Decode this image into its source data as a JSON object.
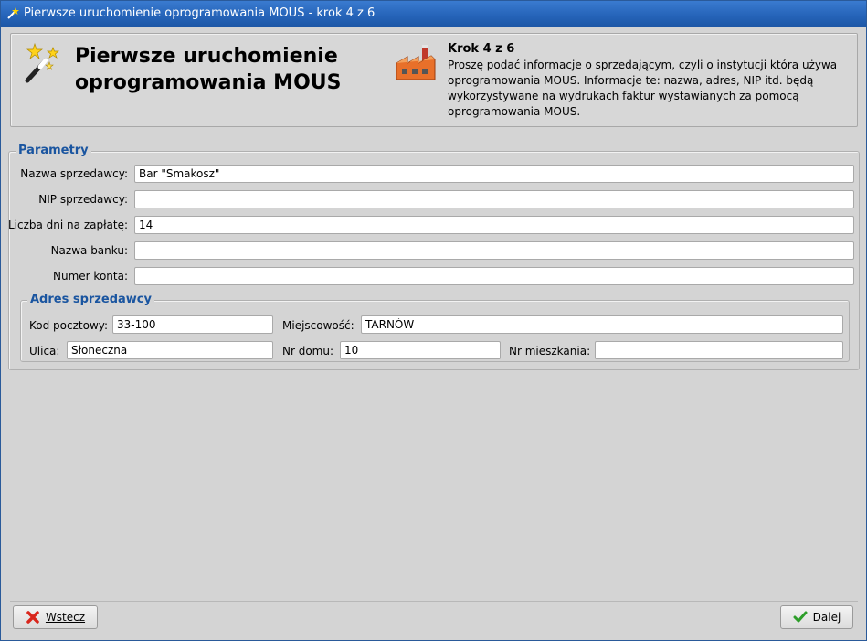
{
  "window": {
    "title": "Pierwsze uruchomienie oprogramowania MOUS - krok 4 z 6",
    "icon": "wand-icon"
  },
  "header": {
    "big_title": "Pierwsze uruchomienie oprogramowania MOUS",
    "step_title": "Krok 4 z 6",
    "step_description": "Proszę podać informacje o sprzedającym, czyli o instytucji która używa oprogramowania MOUS. Informacje te: nazwa, adres, NIP itd. będą wykorzystywane na wydrukach faktur wystawianych za pomocą oprogramowania MOUS.",
    "left_icon": "magic-wand-icon",
    "right_icon": "factory-icon"
  },
  "params": {
    "legend": "Parametry",
    "seller_name_label": "Nazwa sprzedawcy:",
    "seller_name_value": "Bar \"Smakosz\"",
    "nip_label": "NIP sprzedawcy:",
    "nip_value": "",
    "days_label": "Liczba dni na zapłatę:",
    "days_value": "14",
    "bank_label": "Nazwa banku:",
    "bank_value": "",
    "account_label": "Numer konta:",
    "account_value": ""
  },
  "address": {
    "legend": "Adres sprzedawcy",
    "postal_label": "Kod pocztowy:",
    "postal_value": "33-100",
    "city_label": "Miejscowość:",
    "city_value": "TARNÓW",
    "street_label": "Ulica:",
    "street_value": "Słoneczna",
    "house_label": "Nr domu:",
    "house_value": "10",
    "apartment_label": "Nr mieszkania:",
    "apartment_value": ""
  },
  "footer": {
    "back_label": "Wstecz",
    "next_label": "Dalej"
  },
  "colors": {
    "titlebar": "#2563b8",
    "legend": "#1a55a0",
    "background": "#d4d4d4"
  }
}
